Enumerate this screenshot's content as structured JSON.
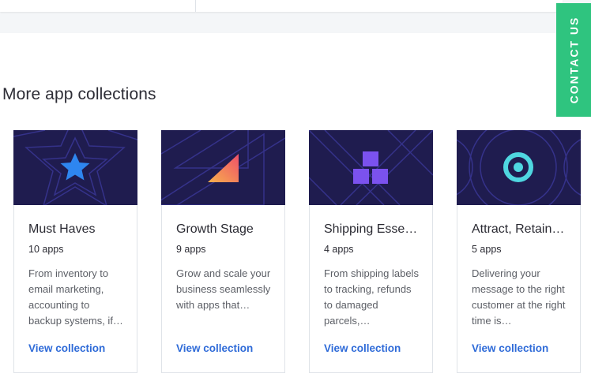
{
  "section": {
    "title": "More app collections"
  },
  "contact": {
    "label": "CONTACT US"
  },
  "collections": [
    {
      "name": "Must Haves",
      "count": "10 apps",
      "description": "From inventory to email marketing, accounting to backup systems, if…",
      "link": "View collection",
      "icon": "star-icon"
    },
    {
      "name": "Growth Stage",
      "count": "9 apps",
      "description": "Grow and scale your business seamlessly with apps that…",
      "link": "View collection",
      "icon": "triangle-icon"
    },
    {
      "name": "Shipping Esse…",
      "count": "4 apps",
      "description": "From shipping labels to tracking, refunds to damaged parcels,…",
      "link": "View collection",
      "icon": "boxes-icon"
    },
    {
      "name": "Attract, Retain…",
      "count": "5 apps",
      "description": "Delivering your message to the right customer at the right time is…",
      "link": "View collection",
      "icon": "target-icon"
    }
  ],
  "colors": {
    "hero": "#1f1c4f",
    "link": "#2f6bd8",
    "contact": "#2fc47f"
  }
}
